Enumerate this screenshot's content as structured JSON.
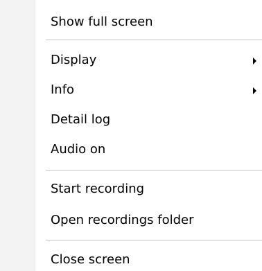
{
  "menu": {
    "items": [
      {
        "label": "Show full screen"
      },
      {
        "label": "Display"
      },
      {
        "label": "Info"
      },
      {
        "label": "Detail log"
      },
      {
        "label": "Audio on"
      },
      {
        "label": "Start recording"
      },
      {
        "label": "Open recordings folder"
      },
      {
        "label": "Close screen"
      }
    ]
  },
  "icons": {
    "submenu_arrow": "submenu-arrow-icon"
  },
  "colors": {
    "background": "#ffffff",
    "gutter": "#f3f3f3",
    "separator": "#c8c8c8",
    "text": "#000000"
  }
}
